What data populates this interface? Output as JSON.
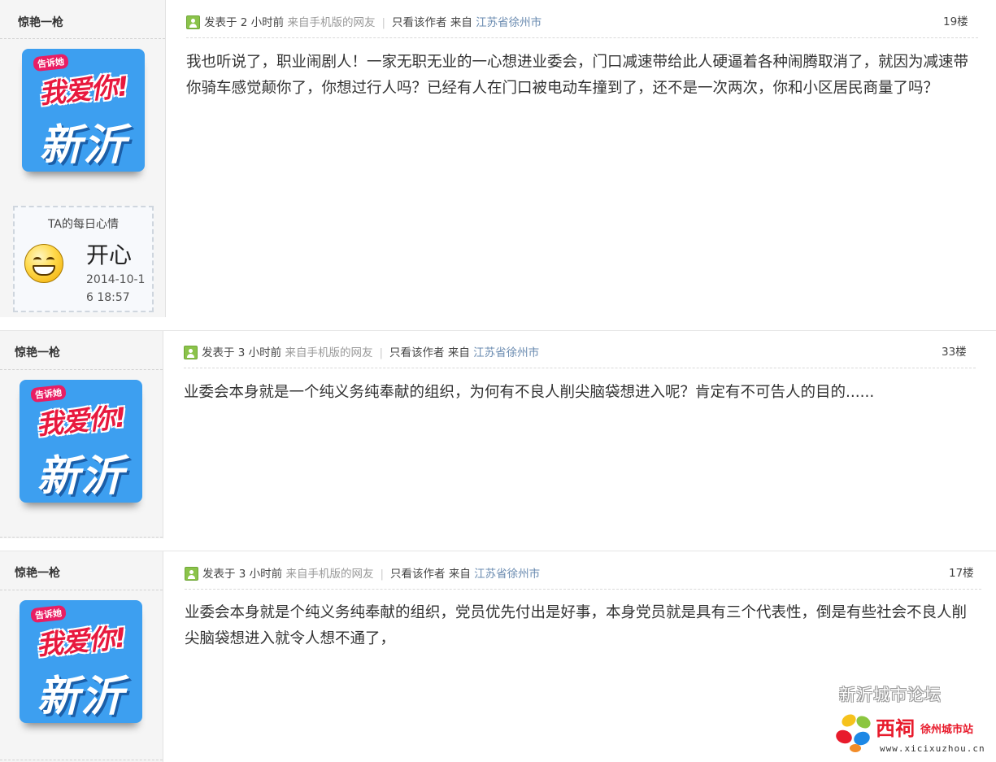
{
  "posts": [
    {
      "author": "惊艳一枪",
      "avatar": {
        "small_tag": "告诉她",
        "love": "我爱你!",
        "city": "新沂"
      },
      "mood": {
        "title": "TA的每日心情",
        "label": "开心",
        "date": "2014-10-16 18:57"
      },
      "posted": "发表于 2 小时前",
      "source": "来自手机版的网友",
      "author_only": "只看该作者",
      "from_label": "来自",
      "location": "江苏省徐州市",
      "floor": "19楼",
      "content": "我也听说了，职业闹剧人！一家无职无业的一心想进业委会，门口减速带给此人硬逼着各种闹腾取消了，就因为减速带你骑车感觉颠你了，你想过行人吗？已经有人在门口被电动车撞到了，还不是一次两次，你和小区居民商量了吗？"
    },
    {
      "author": "惊艳一枪",
      "avatar": {
        "small_tag": "告诉她",
        "love": "我爱你!",
        "city": "新沂"
      },
      "posted": "发表于 3 小时前",
      "source": "来自手机版的网友",
      "author_only": "只看该作者",
      "from_label": "来自",
      "location": "江苏省徐州市",
      "floor": "33楼",
      "content": "业委会本身就是一个纯义务纯奉献的组织，为何有不良人削尖脑袋想进入呢？肯定有不可告人的目的......"
    },
    {
      "author": "惊艳一枪",
      "avatar": {
        "small_tag": "告诉她",
        "love": "我爱你!",
        "city": "新沂"
      },
      "posted": "发表于 3 小时前",
      "source": "来自手机版的网友",
      "author_only": "只看该作者",
      "from_label": "来自",
      "location": "江苏省徐州市",
      "floor": "17楼",
      "content": "业委会本身就是个纯义务纯奉献的组织，党员优先付出是好事，本身党员就是具有三个代表性，倒是有些社会不良人削尖脑袋想进入就令人想不通了，"
    }
  ],
  "watermark": {
    "forum_name": "新沂城市论坛",
    "brand": "西祠",
    "brand_sub": "徐州城市站",
    "url": "www.xicixuzhou.cn"
  }
}
